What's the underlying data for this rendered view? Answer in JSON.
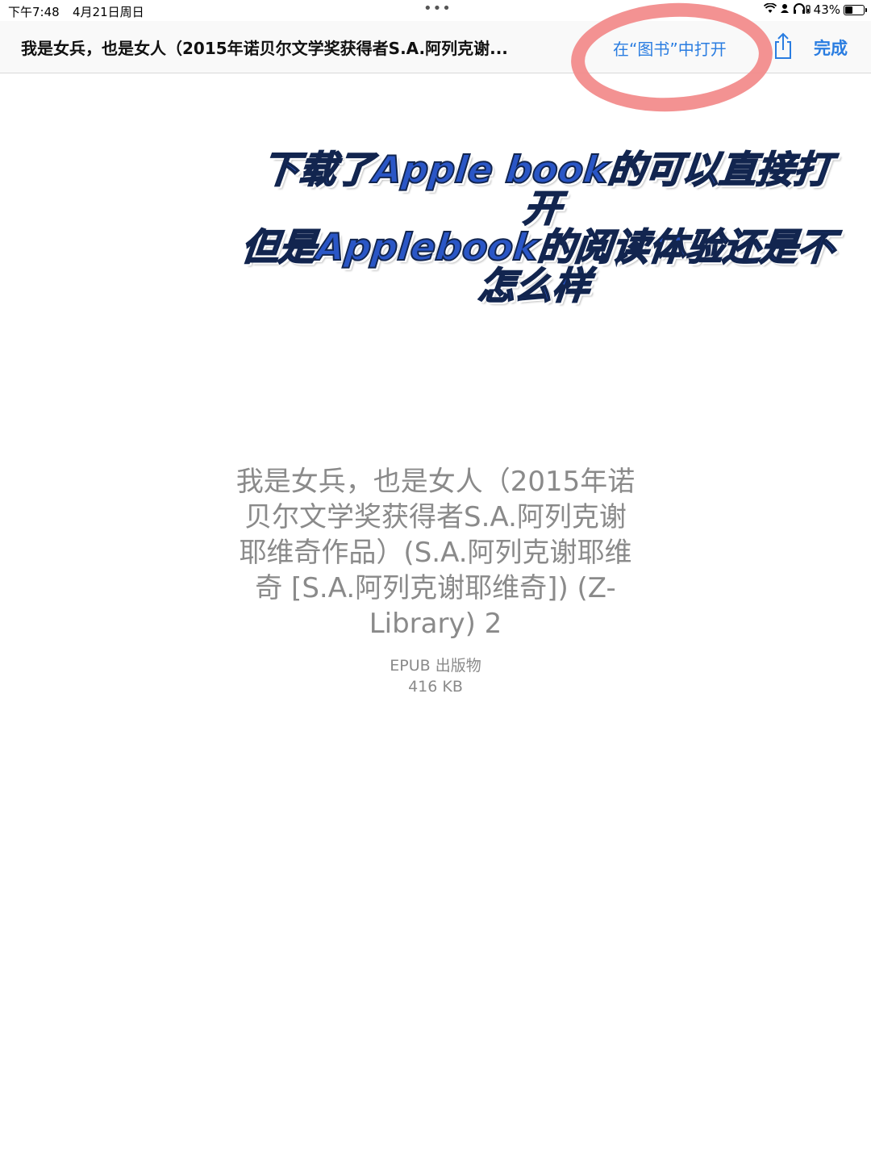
{
  "status_bar": {
    "time": "下午7:48",
    "date": "4月21日周日",
    "multitask_dots": "•••",
    "battery_percent": "43%",
    "battery_level": 0.43,
    "icons": [
      "wifi-icon",
      "person-icon",
      "headphones-icon",
      "battery-icon"
    ]
  },
  "nav": {
    "title": "我是女兵，也是女人（2015年诺贝尔文学奖获得者S.A.阿列克谢...",
    "open_in_books": "在“图书”中打开",
    "share_icon": "share-icon",
    "done": "完成",
    "accent_color": "#2a7de1"
  },
  "annotation": {
    "line1": "下载了Apple book的可以直接打开",
    "line2": "但是Applebook的阅读体验还是不",
    "line3": "怎么样",
    "highlight_color": "#f28c8c"
  },
  "document": {
    "title": "我是女兵，也是女人（2015年诺贝尔文学奖获得者S.A.阿列克谢耶维奇作品）(S.A.阿列克谢耶维奇 [S.A.阿列克谢耶维奇]) (Z-Library) 2",
    "type": "EPUB 出版物",
    "size": "416 KB"
  }
}
